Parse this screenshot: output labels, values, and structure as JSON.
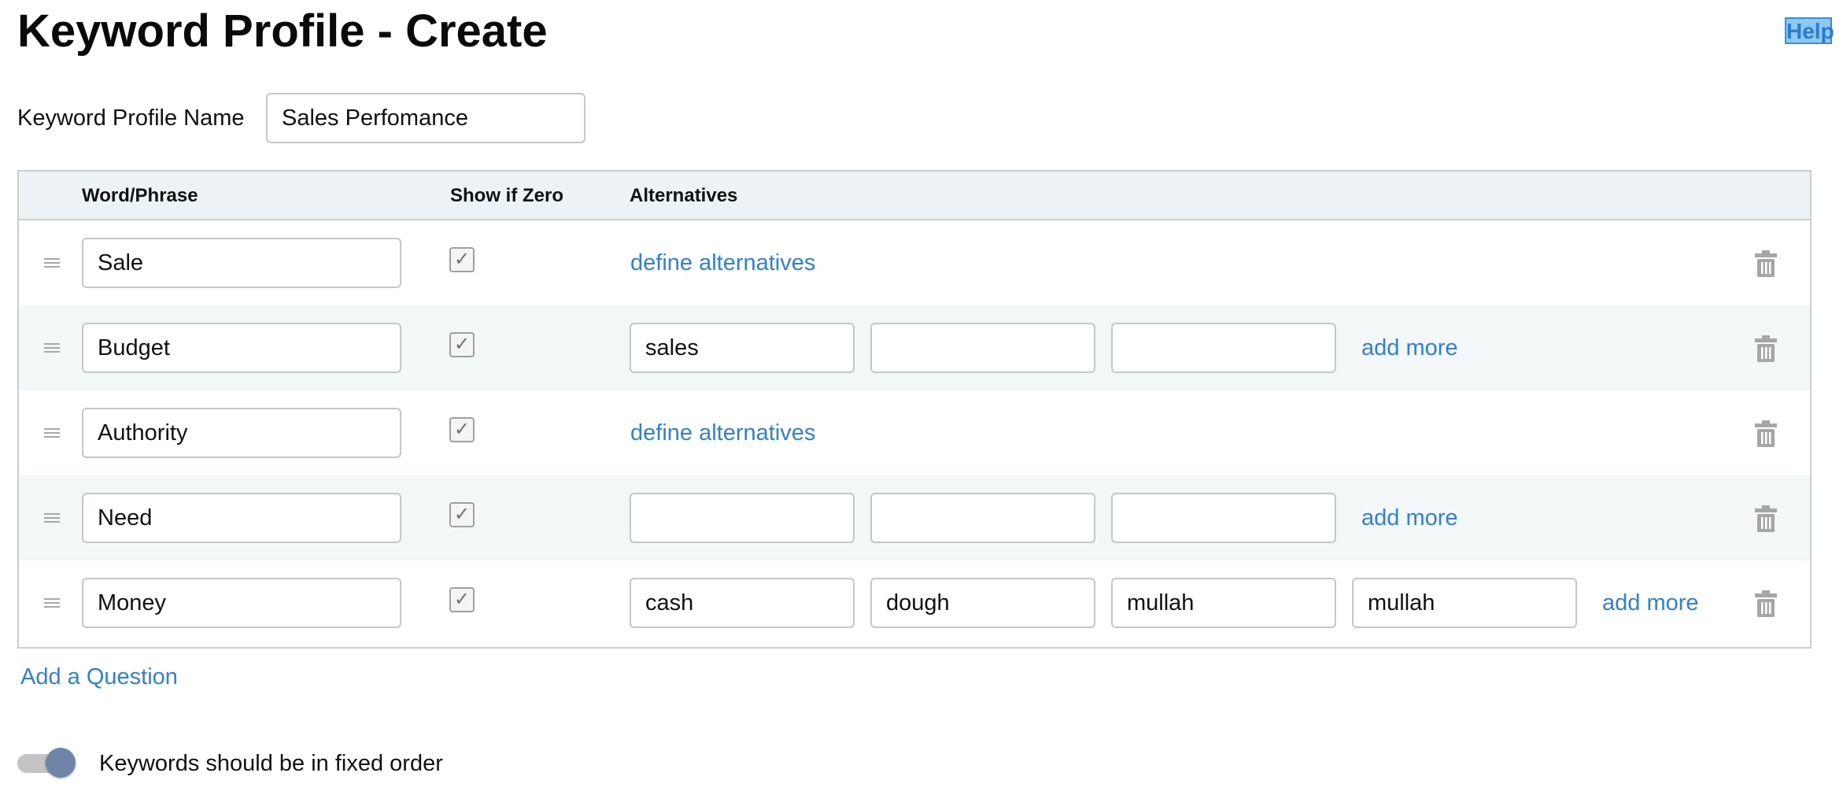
{
  "header": {
    "title": "Keyword Profile - Create",
    "help_label": "Help"
  },
  "profile": {
    "name_label": "Keyword Profile Name",
    "name_value": "Sales Perfomance"
  },
  "table": {
    "columns": {
      "word": "Word/Phrase",
      "zero": "Show if Zero",
      "alternatives": "Alternatives"
    },
    "rows": [
      {
        "word": "Sale",
        "show_if_zero": true,
        "define_label": "define alternatives"
      },
      {
        "word": "Budget",
        "show_if_zero": true,
        "alternatives": [
          "sales",
          "",
          ""
        ],
        "add_more_label": "add more"
      },
      {
        "word": "Authority",
        "show_if_zero": true,
        "define_label": "define alternatives"
      },
      {
        "word": "Need",
        "show_if_zero": true,
        "alternatives": [
          "",
          "",
          ""
        ],
        "add_more_label": "add more"
      },
      {
        "word": "Money",
        "show_if_zero": true,
        "alternatives": [
          "cash",
          "dough",
          "mullah",
          "mullah"
        ],
        "add_more_label": "add more"
      }
    ]
  },
  "footer": {
    "add_question_label": "Add a Question",
    "fixed_order_label": "Keywords should be in fixed order",
    "fixed_order_enabled": true
  },
  "icons": {
    "drag": "drag-handle-icon",
    "check": "checkmark-icon",
    "trash": "trash-icon"
  },
  "colors": {
    "link": "#2f80d8",
    "header_bg": "#edf2f4",
    "shaded_row": "#f3f7f8",
    "toggle_knob": "#6e85a8",
    "help_bg": "#8ec9f2"
  }
}
